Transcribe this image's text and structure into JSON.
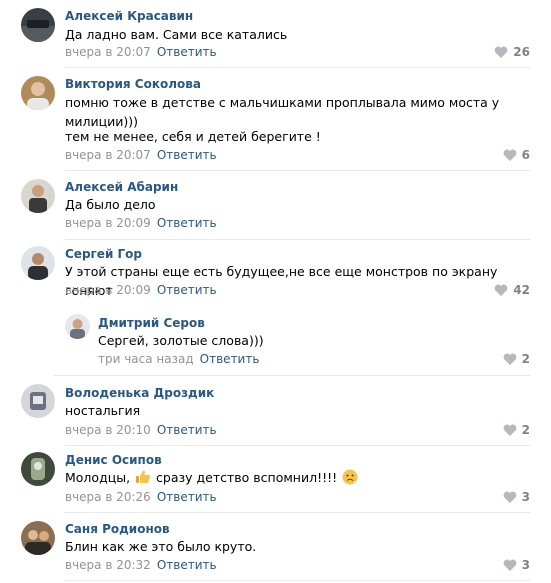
{
  "comments": [
    {
      "author": "Алексей Красавин",
      "text": "Да ладно вам. Сами все катались",
      "time": "вчера в 20:07",
      "reply": "Ответить",
      "likes": "26",
      "avatar_color": "#3b3f44"
    },
    {
      "author": "Виктория Соколова",
      "text": "помню тоже в детстве с мальчишками проплывала мимо моста у милиции)))",
      "text2": "тем не менее, себя и детей берегите !",
      "time": "вчера в 20:07",
      "reply": "Ответить",
      "likes": "6",
      "avatar_color": "#b08a5a"
    },
    {
      "author": "Алексей Абарин",
      "text": "Да было дело",
      "time": "вчера в 20:09",
      "reply": "Ответить",
      "likes": "",
      "avatar_color": "#7a6a5c"
    },
    {
      "author": "Сергей Гор",
      "text": "У этой страны еще есть будущее,не все еще монстров по экрану гоняют",
      "time": "вчера в 20:09",
      "reply": "Ответить",
      "likes": "42",
      "avatar_color": "#4b5563"
    },
    {
      "author": "Дмитрий Серов",
      "text": "Сергей, золотые слова)))",
      "time": "три часа назад",
      "reply": "Ответить",
      "likes": "2",
      "avatar_color": "#9aa0a6"
    },
    {
      "author": "Володенька Дроздик",
      "text": "ностальгия",
      "time": "вчера в 20:10",
      "reply": "Ответить",
      "likes": "2",
      "avatar_color": "#6b7280"
    },
    {
      "author": "Денис Осипов",
      "text_before": "Молодцы,",
      "text_after": "сразу детство вспомнил!!!!",
      "time": "вчера в 20:26",
      "reply": "Ответить",
      "likes": "3",
      "avatar_color": "#3f4a3c"
    },
    {
      "author": "Саня Родионов",
      "text": "Блин как же это было круто.",
      "time": "вчера в 20:32",
      "reply": "Ответить",
      "likes": "3",
      "avatar_color": "#8a6f52"
    }
  ],
  "colors": {
    "link": "#2a5885",
    "meta": "#939393",
    "separator": "#e7e8ec",
    "likes": "#828282"
  },
  "icons": {
    "like": "heart-icon",
    "emoji_thumb": "thumbs-up-emoji",
    "emoji_sad": "sad-face-emoji"
  }
}
